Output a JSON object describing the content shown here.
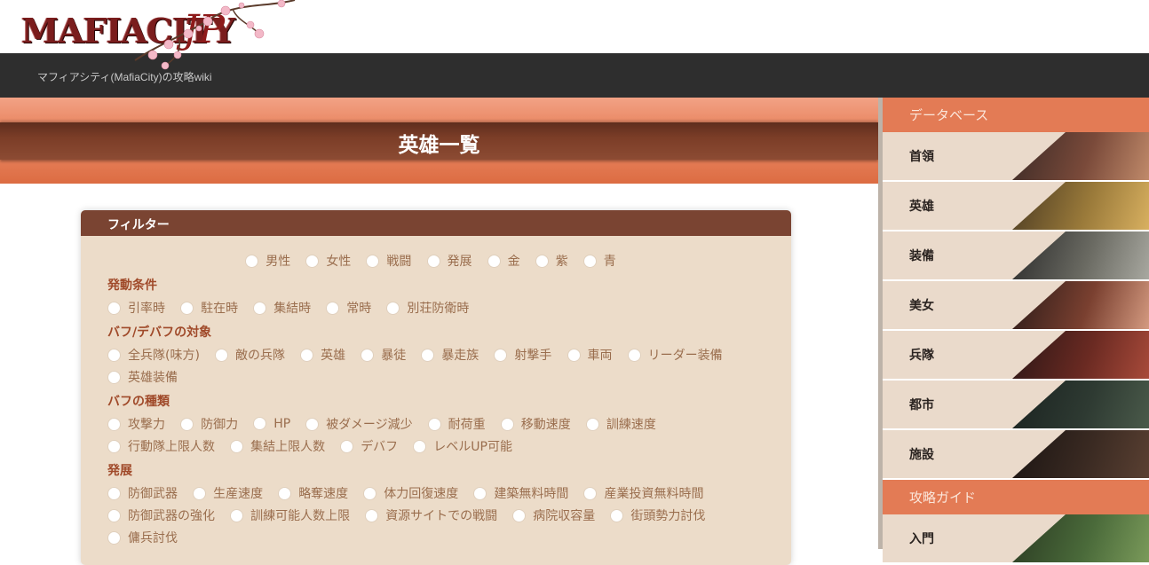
{
  "site": {
    "logo_text": "MAFIACITY",
    "logo_suffix": "JP",
    "tagline": "マフィアシティ(MafiaCity)の攻略wiki"
  },
  "page": {
    "title": "英雄一覧"
  },
  "filter": {
    "title": "フィルター",
    "top_options": [
      "男性",
      "女性",
      "戦闘",
      "発展",
      "金",
      "紫",
      "青"
    ],
    "sections": [
      {
        "label": "発動条件",
        "rows": [
          [
            "引率時",
            "駐在時",
            "集結時",
            "常時",
            "別荘防衛時"
          ]
        ]
      },
      {
        "label": "バフ/デバフの対象",
        "rows": [
          [
            "全兵隊(味方)",
            "敵の兵隊",
            "英雄",
            "暴徒",
            "暴走族",
            "射撃手",
            "車両",
            "リーダー装備"
          ],
          [
            "英雄装備"
          ]
        ]
      },
      {
        "label": "バフの種類",
        "rows": [
          [
            "攻撃力",
            "防御力",
            "HP",
            "被ダメージ減少",
            "耐荷重",
            "移動速度",
            "訓練速度"
          ],
          [
            "行動隊上限人数",
            "集結上限人数",
            "デバフ",
            "レベルUP可能"
          ]
        ]
      },
      {
        "label": "発展",
        "rows": [
          [
            "防御武器",
            "生産速度",
            "略奪速度",
            "体力回復速度",
            "建築無料時間",
            "産業投資無料時間"
          ],
          [
            "防御武器の強化",
            "訓練可能人数上限",
            "資源サイトでの戦闘",
            "病院収容量",
            "街頭勢力討伐"
          ],
          [
            "傭兵討伐"
          ]
        ]
      }
    ]
  },
  "sidebar": {
    "database_heading": "データベース",
    "database_items": [
      {
        "label": "首領",
        "thumb_colors": [
          "#3a2a26",
          "#7a4a3a",
          "#c08a6a"
        ]
      },
      {
        "label": "英雄",
        "thumb_colors": [
          "#4a3a22",
          "#9a7a3a",
          "#d8b060"
        ]
      },
      {
        "label": "装備",
        "thumb_colors": [
          "#2a2a2a",
          "#6a6a62",
          "#a8a8a0"
        ]
      },
      {
        "label": "美女",
        "thumb_colors": [
          "#2a1a18",
          "#7a4030",
          "#d49a80"
        ]
      },
      {
        "label": "兵隊",
        "thumb_colors": [
          "#2a1616",
          "#6a2a22",
          "#a84a3a"
        ]
      },
      {
        "label": "都市",
        "thumb_colors": [
          "#1a2220",
          "#2e3a32",
          "#4a5a4a"
        ]
      },
      {
        "label": "施設",
        "thumb_colors": [
          "#1a1412",
          "#3a2a22",
          "#5a4032"
        ]
      }
    ],
    "guide_heading": "攻略ガイド",
    "guide_items": [
      {
        "label": "入門",
        "thumb_colors": [
          "#2a3a22",
          "#4a6a3a",
          "#7a9a5a"
        ]
      }
    ]
  }
}
